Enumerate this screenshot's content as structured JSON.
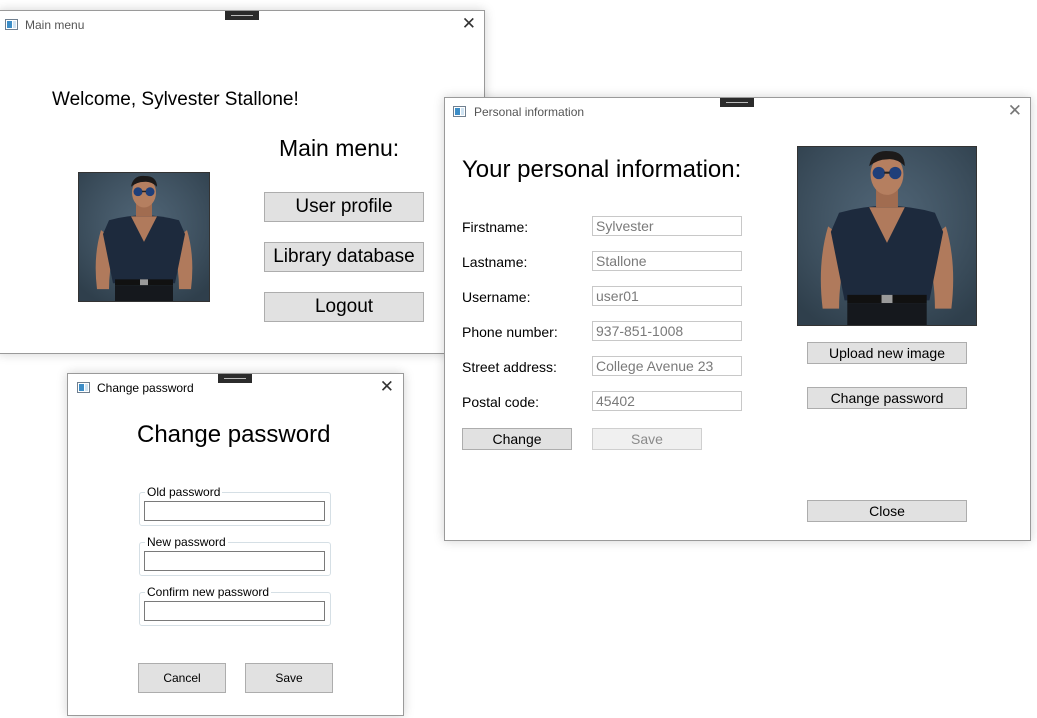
{
  "main_window": {
    "title": "Main menu",
    "welcome": "Welcome, Sylvester Stallone!",
    "heading": "Main menu:",
    "buttons": {
      "user_profile": "User profile",
      "library_database": "Library database",
      "logout": "Logout"
    },
    "close_glyph": "✕"
  },
  "personal_window": {
    "title": "Personal information",
    "heading": "Your personal information:",
    "fields": [
      {
        "label": "Firstname:",
        "value": "Sylvester"
      },
      {
        "label": "Lastname:",
        "value": "Stallone"
      },
      {
        "label": "Username:",
        "value": "user01"
      },
      {
        "label": "Phone number:",
        "value": "937-851-1008"
      },
      {
        "label": "Street address:",
        "value": "College Avenue 23"
      },
      {
        "label": "Postal code:",
        "value": "45402"
      }
    ],
    "buttons": {
      "change": "Change",
      "save": "Save",
      "upload_image": "Upload new image",
      "change_password": "Change password",
      "close": "Close"
    },
    "close_glyph": "✕"
  },
  "password_window": {
    "title": "Change password",
    "heading": "Change password",
    "groups": {
      "old": "Old password",
      "new": "New password",
      "confirm": "Confirm new password"
    },
    "buttons": {
      "cancel": "Cancel",
      "save": "Save"
    },
    "close_glyph": "✕"
  },
  "icons": {
    "window_icon": "app-window-icon",
    "close": "close-icon"
  },
  "colors": {
    "button_bg": "#e1e1e1",
    "button_border": "#adadad",
    "disabled_text": "#8a8a8a",
    "photo_bg": "#3e5363",
    "shirt": "#1d2a3d"
  }
}
